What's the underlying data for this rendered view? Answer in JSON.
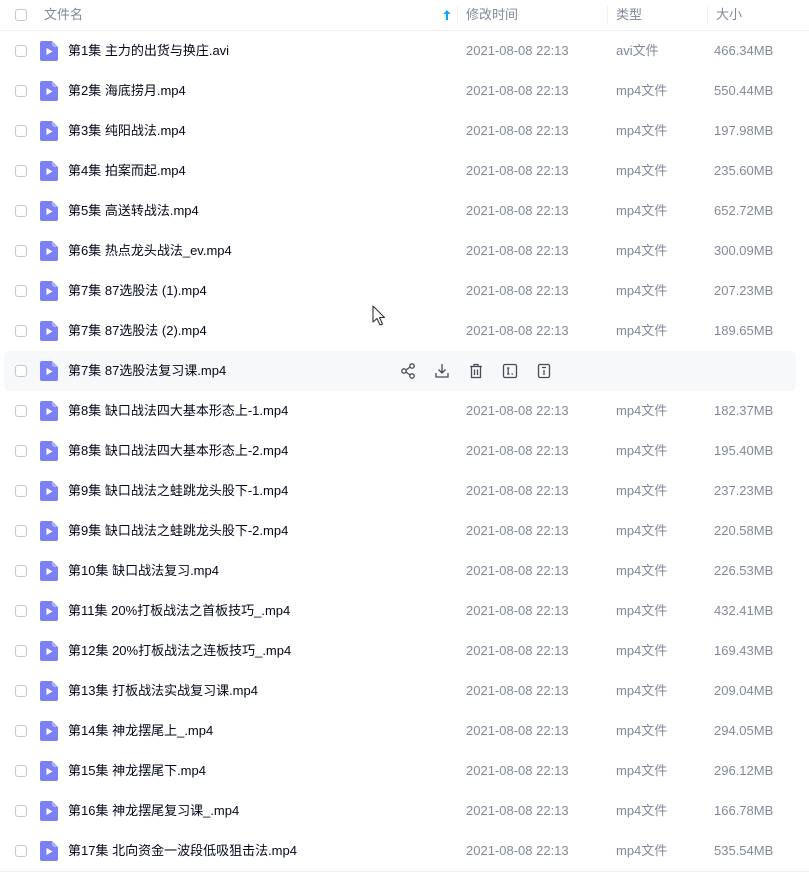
{
  "header": {
    "name_label": "文件名",
    "time_label": "修改时间",
    "type_label": "类型",
    "size_label": "大小"
  },
  "icons": {
    "file": "video-file-icon",
    "sort": "sort-ascending-icon",
    "actions": [
      "share-icon",
      "download-icon",
      "delete-icon",
      "rename-icon",
      "info-icon"
    ]
  },
  "colors": {
    "file_icon": "#7b80f2",
    "muted": "#818999",
    "accent": "#06a7ff"
  },
  "files": [
    {
      "name": "第1集 主力的出货与换庄.avi",
      "time": "2021-08-08 22:13",
      "type": "avi文件",
      "size": "466.34MB"
    },
    {
      "name": "第2集 海底捞月.mp4",
      "time": "2021-08-08 22:13",
      "type": "mp4文件",
      "size": "550.44MB"
    },
    {
      "name": "第3集 纯阳战法.mp4",
      "time": "2021-08-08 22:13",
      "type": "mp4文件",
      "size": "197.98MB"
    },
    {
      "name": "第4集 拍案而起.mp4",
      "time": "2021-08-08 22:13",
      "type": "mp4文件",
      "size": "235.60MB"
    },
    {
      "name": "第5集 高送转战法.mp4",
      "time": "2021-08-08 22:13",
      "type": "mp4文件",
      "size": "652.72MB"
    },
    {
      "name": "第6集 热点龙头战法_ev.mp4",
      "time": "2021-08-08 22:13",
      "type": "mp4文件",
      "size": "300.09MB"
    },
    {
      "name": "第7集 87选股法 (1).mp4",
      "time": "2021-08-08 22:13",
      "type": "mp4文件",
      "size": "207.23MB"
    },
    {
      "name": "第7集 87选股法 (2).mp4",
      "time": "2021-08-08 22:13",
      "type": "mp4文件",
      "size": "189.65MB"
    },
    {
      "name": "第7集 87选股法复习课.mp4",
      "time": "",
      "type": "",
      "size": "",
      "hover": true
    },
    {
      "name": "第8集 缺口战法四大基本形态上-1.mp4",
      "time": "2021-08-08 22:13",
      "type": "mp4文件",
      "size": "182.37MB"
    },
    {
      "name": "第8集 缺口战法四大基本形态上-2.mp4",
      "time": "2021-08-08 22:13",
      "type": "mp4文件",
      "size": "195.40MB"
    },
    {
      "name": "第9集 缺口战法之蛙跳龙头股下-1.mp4",
      "time": "2021-08-08 22:13",
      "type": "mp4文件",
      "size": "237.23MB"
    },
    {
      "name": "第9集 缺口战法之蛙跳龙头股下-2.mp4",
      "time": "2021-08-08 22:13",
      "type": "mp4文件",
      "size": "220.58MB"
    },
    {
      "name": "第10集 缺口战法复习.mp4",
      "time": "2021-08-08 22:13",
      "type": "mp4文件",
      "size": "226.53MB"
    },
    {
      "name": "第11集 20%打板战法之首板技巧_.mp4",
      "time": "2021-08-08 22:13",
      "type": "mp4文件",
      "size": "432.41MB"
    },
    {
      "name": "第12集 20%打板战法之连板技巧_.mp4",
      "time": "2021-08-08 22:13",
      "type": "mp4文件",
      "size": "169.43MB"
    },
    {
      "name": "第13集 打板战法实战复习课.mp4",
      "time": "2021-08-08 22:13",
      "type": "mp4文件",
      "size": "209.04MB"
    },
    {
      "name": "第14集 神龙摆尾上_.mp4",
      "time": "2021-08-08 22:13",
      "type": "mp4文件",
      "size": "294.05MB"
    },
    {
      "name": "第15集 神龙摆尾下.mp4",
      "time": "2021-08-08 22:13",
      "type": "mp4文件",
      "size": "296.12MB"
    },
    {
      "name": "第16集 神龙摆尾复习课_.mp4",
      "time": "2021-08-08 22:13",
      "type": "mp4文件",
      "size": "166.78MB"
    },
    {
      "name": "第17集 北向资金一波段低吸狙击法.mp4",
      "time": "2021-08-08 22:13",
      "type": "mp4文件",
      "size": "535.54MB"
    }
  ]
}
